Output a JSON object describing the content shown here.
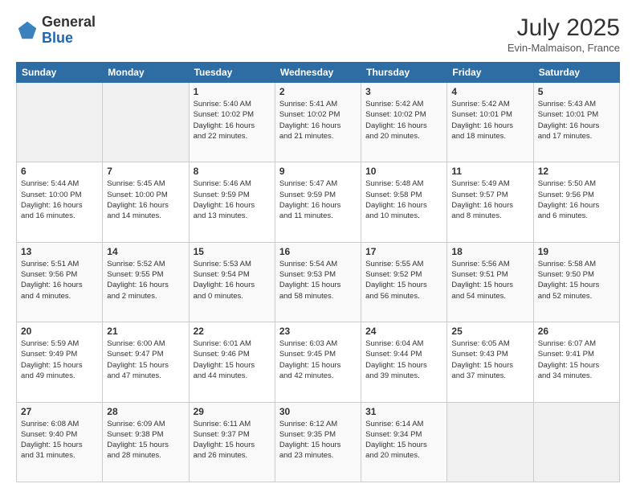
{
  "header": {
    "logo_general": "General",
    "logo_blue": "Blue",
    "month_title": "July 2025",
    "location": "Evin-Malmaison, France"
  },
  "weekdays": [
    "Sunday",
    "Monday",
    "Tuesday",
    "Wednesday",
    "Thursday",
    "Friday",
    "Saturday"
  ],
  "weeks": [
    [
      {
        "day": "",
        "info": ""
      },
      {
        "day": "",
        "info": ""
      },
      {
        "day": "1",
        "info": "Sunrise: 5:40 AM\nSunset: 10:02 PM\nDaylight: 16 hours\nand 22 minutes."
      },
      {
        "day": "2",
        "info": "Sunrise: 5:41 AM\nSunset: 10:02 PM\nDaylight: 16 hours\nand 21 minutes."
      },
      {
        "day": "3",
        "info": "Sunrise: 5:42 AM\nSunset: 10:02 PM\nDaylight: 16 hours\nand 20 minutes."
      },
      {
        "day": "4",
        "info": "Sunrise: 5:42 AM\nSunset: 10:01 PM\nDaylight: 16 hours\nand 18 minutes."
      },
      {
        "day": "5",
        "info": "Sunrise: 5:43 AM\nSunset: 10:01 PM\nDaylight: 16 hours\nand 17 minutes."
      }
    ],
    [
      {
        "day": "6",
        "info": "Sunrise: 5:44 AM\nSunset: 10:00 PM\nDaylight: 16 hours\nand 16 minutes."
      },
      {
        "day": "7",
        "info": "Sunrise: 5:45 AM\nSunset: 10:00 PM\nDaylight: 16 hours\nand 14 minutes."
      },
      {
        "day": "8",
        "info": "Sunrise: 5:46 AM\nSunset: 9:59 PM\nDaylight: 16 hours\nand 13 minutes."
      },
      {
        "day": "9",
        "info": "Sunrise: 5:47 AM\nSunset: 9:59 PM\nDaylight: 16 hours\nand 11 minutes."
      },
      {
        "day": "10",
        "info": "Sunrise: 5:48 AM\nSunset: 9:58 PM\nDaylight: 16 hours\nand 10 minutes."
      },
      {
        "day": "11",
        "info": "Sunrise: 5:49 AM\nSunset: 9:57 PM\nDaylight: 16 hours\nand 8 minutes."
      },
      {
        "day": "12",
        "info": "Sunrise: 5:50 AM\nSunset: 9:56 PM\nDaylight: 16 hours\nand 6 minutes."
      }
    ],
    [
      {
        "day": "13",
        "info": "Sunrise: 5:51 AM\nSunset: 9:56 PM\nDaylight: 16 hours\nand 4 minutes."
      },
      {
        "day": "14",
        "info": "Sunrise: 5:52 AM\nSunset: 9:55 PM\nDaylight: 16 hours\nand 2 minutes."
      },
      {
        "day": "15",
        "info": "Sunrise: 5:53 AM\nSunset: 9:54 PM\nDaylight: 16 hours\nand 0 minutes."
      },
      {
        "day": "16",
        "info": "Sunrise: 5:54 AM\nSunset: 9:53 PM\nDaylight: 15 hours\nand 58 minutes."
      },
      {
        "day": "17",
        "info": "Sunrise: 5:55 AM\nSunset: 9:52 PM\nDaylight: 15 hours\nand 56 minutes."
      },
      {
        "day": "18",
        "info": "Sunrise: 5:56 AM\nSunset: 9:51 PM\nDaylight: 15 hours\nand 54 minutes."
      },
      {
        "day": "19",
        "info": "Sunrise: 5:58 AM\nSunset: 9:50 PM\nDaylight: 15 hours\nand 52 minutes."
      }
    ],
    [
      {
        "day": "20",
        "info": "Sunrise: 5:59 AM\nSunset: 9:49 PM\nDaylight: 15 hours\nand 49 minutes."
      },
      {
        "day": "21",
        "info": "Sunrise: 6:00 AM\nSunset: 9:47 PM\nDaylight: 15 hours\nand 47 minutes."
      },
      {
        "day": "22",
        "info": "Sunrise: 6:01 AM\nSunset: 9:46 PM\nDaylight: 15 hours\nand 44 minutes."
      },
      {
        "day": "23",
        "info": "Sunrise: 6:03 AM\nSunset: 9:45 PM\nDaylight: 15 hours\nand 42 minutes."
      },
      {
        "day": "24",
        "info": "Sunrise: 6:04 AM\nSunset: 9:44 PM\nDaylight: 15 hours\nand 39 minutes."
      },
      {
        "day": "25",
        "info": "Sunrise: 6:05 AM\nSunset: 9:43 PM\nDaylight: 15 hours\nand 37 minutes."
      },
      {
        "day": "26",
        "info": "Sunrise: 6:07 AM\nSunset: 9:41 PM\nDaylight: 15 hours\nand 34 minutes."
      }
    ],
    [
      {
        "day": "27",
        "info": "Sunrise: 6:08 AM\nSunset: 9:40 PM\nDaylight: 15 hours\nand 31 minutes."
      },
      {
        "day": "28",
        "info": "Sunrise: 6:09 AM\nSunset: 9:38 PM\nDaylight: 15 hours\nand 28 minutes."
      },
      {
        "day": "29",
        "info": "Sunrise: 6:11 AM\nSunset: 9:37 PM\nDaylight: 15 hours\nand 26 minutes."
      },
      {
        "day": "30",
        "info": "Sunrise: 6:12 AM\nSunset: 9:35 PM\nDaylight: 15 hours\nand 23 minutes."
      },
      {
        "day": "31",
        "info": "Sunrise: 6:14 AM\nSunset: 9:34 PM\nDaylight: 15 hours\nand 20 minutes."
      },
      {
        "day": "",
        "info": ""
      },
      {
        "day": "",
        "info": ""
      }
    ]
  ]
}
